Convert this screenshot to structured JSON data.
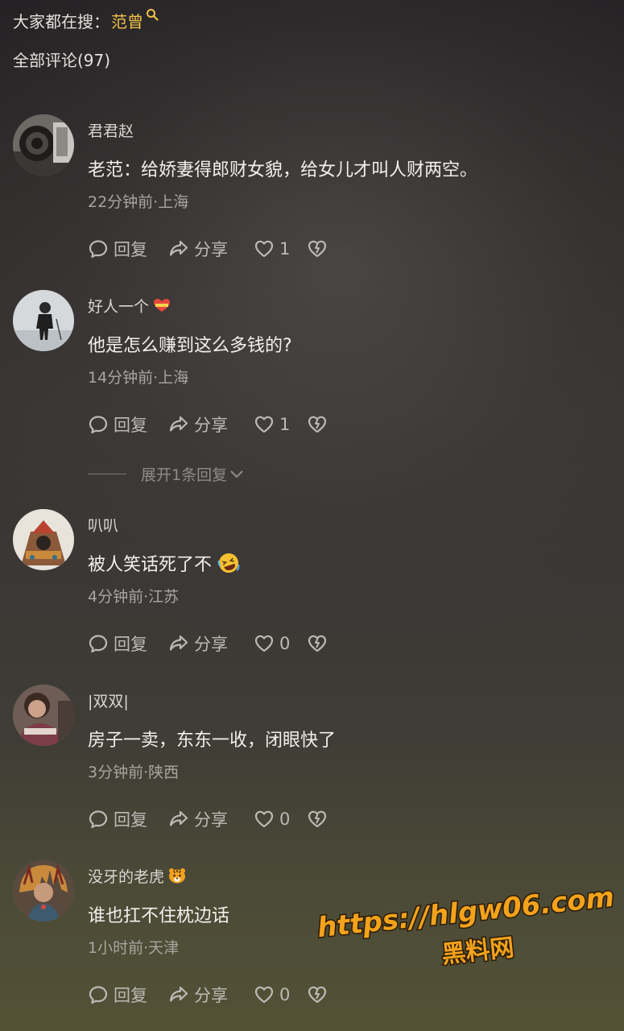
{
  "header": {
    "search_prefix": "大家都在搜：",
    "search_keyword": "范曾",
    "comments_title": "全部评论(97)"
  },
  "actions": {
    "reply": "回复",
    "share": "分享"
  },
  "comments": [
    {
      "username": "君君赵",
      "text": "老范：给娇妻得郎财女貌，给女儿才叫人财两空。",
      "time_location": "22分钟前·上海",
      "likes": "1"
    },
    {
      "username": "好人一个",
      "text": "他是怎么赚到这么多钱的?",
      "time_location": "14分钟前·上海",
      "likes": "1"
    },
    {
      "username": "叭叭",
      "text": "被人笑话死了不",
      "time_location": "4分钟前·江苏",
      "likes": "0"
    },
    {
      "username": "|双双|",
      "text": "房子一卖，东东一收，闭眼快了",
      "time_location": "3分钟前·陕西",
      "likes": "0"
    },
    {
      "username": "没牙的老虎",
      "text": "谁也扛不住枕边话",
      "time_location": "1小时前·天津",
      "likes": "0"
    }
  ],
  "expand_replies": "展开1条回复",
  "watermark": {
    "url": "https://hlgw06.com",
    "name": "黑料网"
  },
  "colors": {
    "accent_keyword": "#f0c24a",
    "watermark_fill": "#f3a21c"
  }
}
